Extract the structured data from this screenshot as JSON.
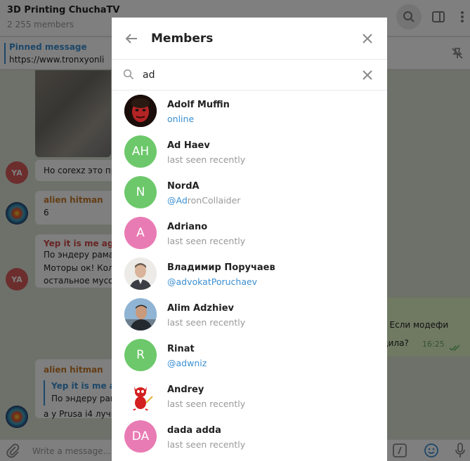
{
  "chat": {
    "title": "3D Printing ChuchaTV",
    "subtitle": "2 255 members",
    "pinned_label": "Pinned message",
    "pinned_text": "https://www.tronxyonli",
    "messages": [
      {
        "avatar": "YA",
        "text": "Но corexz это пр"
      },
      {
        "name": "alien hitman",
        "text": "6"
      },
      {
        "name": "Yep it is me aga",
        "lines": [
          "По эндеру рама",
          "Моторы ок! Кол",
          "остальное мусо"
        ],
        "avatar": "YA"
      },
      {
        "name": "alien hitman",
        "reply_name": "Yep it is me ag",
        "reply_text": "По эндеру рам",
        "text": "а у Prusa i4 лучш"
      }
    ],
    "outgoing": {
      "line1": "о? Если модефи",
      "line2": "одила?",
      "time": "16:25"
    },
    "input_placeholder": "Write a message..."
  },
  "modal": {
    "title": "Members",
    "search_value": "ad",
    "members": [
      {
        "name": "Adolf Muffin",
        "status": "online",
        "status_type": "online",
        "avatar_type": "photo",
        "photo": "dark-red-face"
      },
      {
        "name": "Ad Haev",
        "status": "last seen recently",
        "status_type": "seen",
        "initials": "AH",
        "color": "#6cc86a"
      },
      {
        "name": "NordA",
        "status_prefix": "@",
        "status_hl": "Ad",
        "status_rest": "ronCollaider",
        "status_type": "username",
        "initials": "N",
        "color": "#6cc86a"
      },
      {
        "name": "Adriano",
        "status": "last seen recently",
        "status_type": "seen",
        "initials": "A",
        "color": "#e97bb4"
      },
      {
        "name": "Владимир Поручаев",
        "status_prefix": "@",
        "status_hl": "ad",
        "status_rest": "vokatPoruchaev",
        "status_type": "username",
        "avatar_type": "photo",
        "photo": "man-portrait"
      },
      {
        "name": "Alim Adzhiev",
        "status": "last seen recently",
        "status_type": "seen",
        "avatar_type": "photo",
        "photo": "man-outdoor"
      },
      {
        "name": "Rinat",
        "status_prefix": "@",
        "status_hl": "ad",
        "status_rest": "wniz",
        "status_type": "username",
        "initials": "R",
        "color": "#6cc86a"
      },
      {
        "name": "Andrey",
        "status": "last seen recently",
        "status_type": "seen",
        "avatar_type": "photo",
        "photo": "bsd-daemon"
      },
      {
        "name": "dada adda",
        "status": "last seen recently",
        "status_type": "seen",
        "initials": "DA",
        "color": "#e97bb4"
      }
    ]
  },
  "icons": {
    "back": "arrow-left-icon",
    "close": "close-icon",
    "search": "search-icon",
    "clear": "clear-search-icon"
  },
  "colors": {
    "accent": "#3a8fd1",
    "green_avatar": "#6cc86a",
    "pink_avatar": "#e97bb4",
    "overlay": "rgba(0,0,0,0.5)"
  }
}
